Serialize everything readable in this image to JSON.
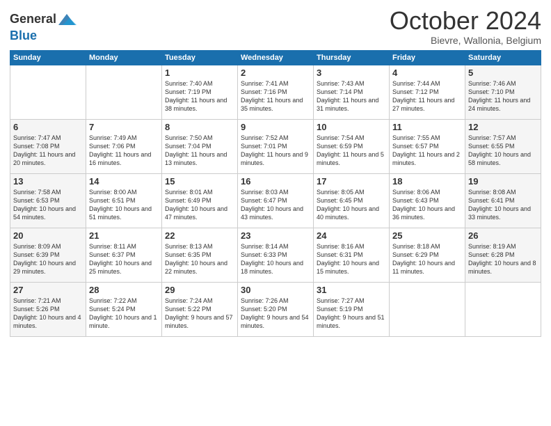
{
  "header": {
    "logo_line1": "General",
    "logo_line2": "Blue",
    "month": "October 2024",
    "location": "Bievre, Wallonia, Belgium"
  },
  "days_of_week": [
    "Sunday",
    "Monday",
    "Tuesday",
    "Wednesday",
    "Thursday",
    "Friday",
    "Saturday"
  ],
  "weeks": [
    [
      {
        "day": "",
        "info": ""
      },
      {
        "day": "",
        "info": ""
      },
      {
        "day": "1",
        "info": "Sunrise: 7:40 AM\nSunset: 7:19 PM\nDaylight: 11 hours and 38 minutes."
      },
      {
        "day": "2",
        "info": "Sunrise: 7:41 AM\nSunset: 7:16 PM\nDaylight: 11 hours and 35 minutes."
      },
      {
        "day": "3",
        "info": "Sunrise: 7:43 AM\nSunset: 7:14 PM\nDaylight: 11 hours and 31 minutes."
      },
      {
        "day": "4",
        "info": "Sunrise: 7:44 AM\nSunset: 7:12 PM\nDaylight: 11 hours and 27 minutes."
      },
      {
        "day": "5",
        "info": "Sunrise: 7:46 AM\nSunset: 7:10 PM\nDaylight: 11 hours and 24 minutes."
      }
    ],
    [
      {
        "day": "6",
        "info": "Sunrise: 7:47 AM\nSunset: 7:08 PM\nDaylight: 11 hours and 20 minutes."
      },
      {
        "day": "7",
        "info": "Sunrise: 7:49 AM\nSunset: 7:06 PM\nDaylight: 11 hours and 16 minutes."
      },
      {
        "day": "8",
        "info": "Sunrise: 7:50 AM\nSunset: 7:04 PM\nDaylight: 11 hours and 13 minutes."
      },
      {
        "day": "9",
        "info": "Sunrise: 7:52 AM\nSunset: 7:01 PM\nDaylight: 11 hours and 9 minutes."
      },
      {
        "day": "10",
        "info": "Sunrise: 7:54 AM\nSunset: 6:59 PM\nDaylight: 11 hours and 5 minutes."
      },
      {
        "day": "11",
        "info": "Sunrise: 7:55 AM\nSunset: 6:57 PM\nDaylight: 11 hours and 2 minutes."
      },
      {
        "day": "12",
        "info": "Sunrise: 7:57 AM\nSunset: 6:55 PM\nDaylight: 10 hours and 58 minutes."
      }
    ],
    [
      {
        "day": "13",
        "info": "Sunrise: 7:58 AM\nSunset: 6:53 PM\nDaylight: 10 hours and 54 minutes."
      },
      {
        "day": "14",
        "info": "Sunrise: 8:00 AM\nSunset: 6:51 PM\nDaylight: 10 hours and 51 minutes."
      },
      {
        "day": "15",
        "info": "Sunrise: 8:01 AM\nSunset: 6:49 PM\nDaylight: 10 hours and 47 minutes."
      },
      {
        "day": "16",
        "info": "Sunrise: 8:03 AM\nSunset: 6:47 PM\nDaylight: 10 hours and 43 minutes."
      },
      {
        "day": "17",
        "info": "Sunrise: 8:05 AM\nSunset: 6:45 PM\nDaylight: 10 hours and 40 minutes."
      },
      {
        "day": "18",
        "info": "Sunrise: 8:06 AM\nSunset: 6:43 PM\nDaylight: 10 hours and 36 minutes."
      },
      {
        "day": "19",
        "info": "Sunrise: 8:08 AM\nSunset: 6:41 PM\nDaylight: 10 hours and 33 minutes."
      }
    ],
    [
      {
        "day": "20",
        "info": "Sunrise: 8:09 AM\nSunset: 6:39 PM\nDaylight: 10 hours and 29 minutes."
      },
      {
        "day": "21",
        "info": "Sunrise: 8:11 AM\nSunset: 6:37 PM\nDaylight: 10 hours and 25 minutes."
      },
      {
        "day": "22",
        "info": "Sunrise: 8:13 AM\nSunset: 6:35 PM\nDaylight: 10 hours and 22 minutes."
      },
      {
        "day": "23",
        "info": "Sunrise: 8:14 AM\nSunset: 6:33 PM\nDaylight: 10 hours and 18 minutes."
      },
      {
        "day": "24",
        "info": "Sunrise: 8:16 AM\nSunset: 6:31 PM\nDaylight: 10 hours and 15 minutes."
      },
      {
        "day": "25",
        "info": "Sunrise: 8:18 AM\nSunset: 6:29 PM\nDaylight: 10 hours and 11 minutes."
      },
      {
        "day": "26",
        "info": "Sunrise: 8:19 AM\nSunset: 6:28 PM\nDaylight: 10 hours and 8 minutes."
      }
    ],
    [
      {
        "day": "27",
        "info": "Sunrise: 7:21 AM\nSunset: 5:26 PM\nDaylight: 10 hours and 4 minutes."
      },
      {
        "day": "28",
        "info": "Sunrise: 7:22 AM\nSunset: 5:24 PM\nDaylight: 10 hours and 1 minute."
      },
      {
        "day": "29",
        "info": "Sunrise: 7:24 AM\nSunset: 5:22 PM\nDaylight: 9 hours and 57 minutes."
      },
      {
        "day": "30",
        "info": "Sunrise: 7:26 AM\nSunset: 5:20 PM\nDaylight: 9 hours and 54 minutes."
      },
      {
        "day": "31",
        "info": "Sunrise: 7:27 AM\nSunset: 5:19 PM\nDaylight: 9 hours and 51 minutes."
      },
      {
        "day": "",
        "info": ""
      },
      {
        "day": "",
        "info": ""
      }
    ]
  ]
}
